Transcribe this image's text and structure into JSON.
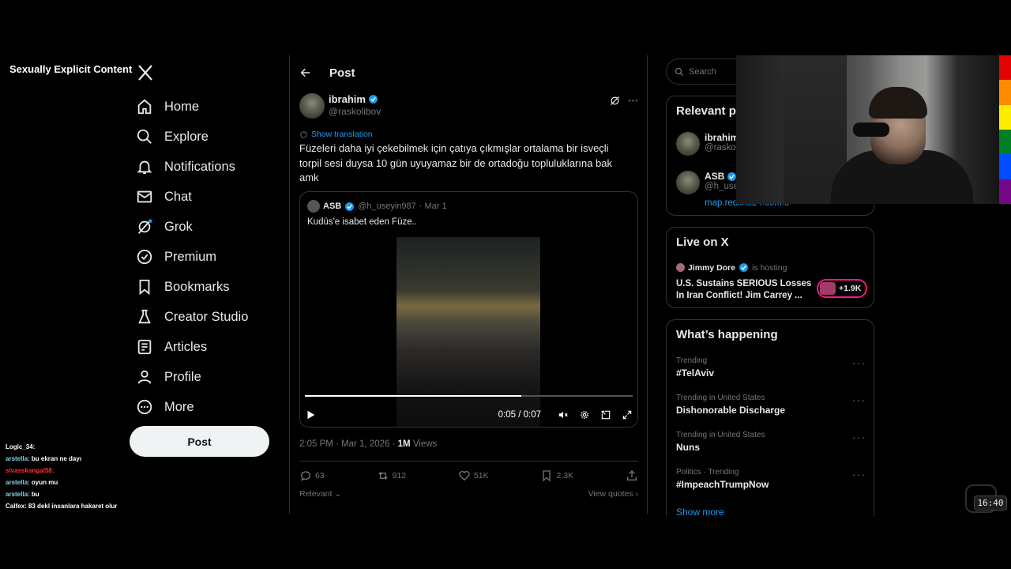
{
  "overlay": {
    "content_label": "Sexually Explicit Content"
  },
  "nav": {
    "items": [
      {
        "label": "Home",
        "icon": "home-icon"
      },
      {
        "label": "Explore",
        "icon": "search-icon"
      },
      {
        "label": "Notifications",
        "icon": "bell-icon"
      },
      {
        "label": "Chat",
        "icon": "mail-icon"
      },
      {
        "label": "Grok",
        "icon": "grok-icon"
      },
      {
        "label": "Premium",
        "icon": "premium-icon"
      },
      {
        "label": "Bookmarks",
        "icon": "bookmark-icon"
      },
      {
        "label": "Creator Studio",
        "icon": "flask-icon"
      },
      {
        "label": "Articles",
        "icon": "article-icon"
      },
      {
        "label": "Profile",
        "icon": "person-icon"
      },
      {
        "label": "More",
        "icon": "more-circle-icon"
      }
    ],
    "post_button": "Post"
  },
  "post": {
    "header_title": "Post",
    "author_name": "ibrahim",
    "author_handle": "@raskolibov",
    "show_translation": "Show translation",
    "text": "Füzeleri daha iyi çekebilmek için çatıya çıkmışlar ortalama bir isveçli torpil sesi duysa 10 gün uyuyamaz bir de ortadoğu topluluklarına bak amk",
    "quote": {
      "name": "ASB",
      "handle": "@h_useyin987",
      "date": "· Mar 1",
      "text": "Kudüs'e isabet eden Füze..",
      "video_time": "0:05 / 0:07",
      "progress": 0.66
    },
    "timestamp": "2:05 PM · Mar 1, 2026 · ",
    "views_count": "1M",
    "views_label": " Views",
    "stats": {
      "replies": "63",
      "reposts": "912",
      "likes": "51K",
      "bookmarks": "2.3K"
    },
    "sort_label": "Relevant",
    "view_quotes": "View quotes"
  },
  "right": {
    "search_placeholder": "Search",
    "relevant": {
      "title": "Relevant p",
      "users": [
        {
          "name": "ibrahim",
          "handle": "@raskol"
        },
        {
          "name": "ASB",
          "handle": "@h_usey"
        }
      ],
      "link": "map.redline24.com.tr"
    },
    "live": {
      "title": "Live on X",
      "host_name": "Jimmy Dore",
      "host_status": "is hosting",
      "stream_title": "U.S. Sustains SERIOUS Losses In Iran Conflict! Jim Carrey ...",
      "listeners": "+1.9K"
    },
    "happening": {
      "title": "What’s happening",
      "trends": [
        {
          "context": "Trending",
          "topic": "#TelAviv"
        },
        {
          "context": "Trending in United States",
          "topic": "Dishonorable Discharge"
        },
        {
          "context": "Trending in United States",
          "topic": "Nuns"
        },
        {
          "context": "Politics · Trending",
          "topic": "#ImpeachTrumpNow"
        }
      ],
      "show_more": "Show more"
    }
  },
  "chat": [
    {
      "user": "Logic_34:",
      "text": "",
      "color": "#ffffff"
    },
    {
      "user": "arstella:",
      "text": "bu ekran ne dayı",
      "color": "#7fd3e8"
    },
    {
      "user": "sivasskangal58:",
      "text": "",
      "color": "#ff3030"
    },
    {
      "user": "arstella:",
      "text": "oyun mu",
      "color": "#7fd3e8"
    },
    {
      "user": "arstella:",
      "text": "bu",
      "color": "#7fd3e8"
    },
    {
      "user": "Calfex:",
      "text": "83 dekl insanlara hakaret olur",
      "color": "#ffffff"
    }
  ],
  "clock": "16:40",
  "colors": {
    "accent": "#1d9bf0",
    "live": "#f91880"
  }
}
